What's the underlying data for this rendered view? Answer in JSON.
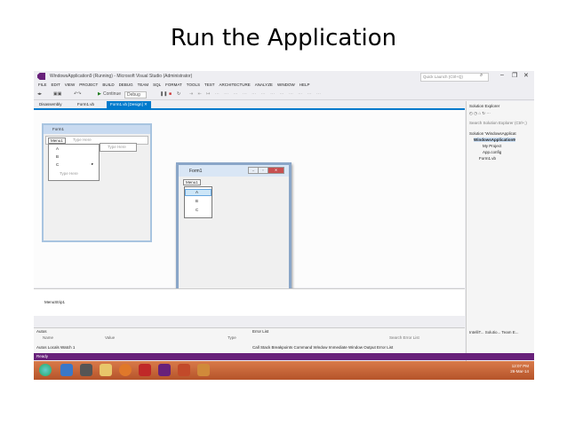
{
  "slide": {
    "title": "Run the Application"
  },
  "window": {
    "title": "WindowsApplication9 (Running) - Microsoft Visual Studio (Administrator)",
    "quick_launch": "Quick Launch (Ctrl+Q)"
  },
  "menu": [
    "FILE",
    "EDIT",
    "VIEW",
    "PROJECT",
    "BUILD",
    "DEBUG",
    "TEAM",
    "SQL",
    "FORMAT",
    "TOOLS",
    "TEST",
    "ARCHITECTURE",
    "ANALYZE",
    "WINDOW",
    "HELP"
  ],
  "toolbar": {
    "continue": "Continue",
    "config": "Debug"
  },
  "tabs": [
    "Disassembly",
    "Form1.vb",
    "Form1.vb [Design]"
  ],
  "designer": {
    "form_caption": "Form1",
    "menu_item": "Menu1",
    "type_here": "Type Here",
    "dropdown": [
      "A",
      "B",
      "C"
    ],
    "sub_type_here": "Type Here",
    "dd_type_here": "Type Here"
  },
  "runtime": {
    "caption": "Form1",
    "menu_item": "Menu1",
    "items": [
      "A",
      "B",
      "C"
    ]
  },
  "tray": {
    "component": "MenuStrip1"
  },
  "solution": {
    "header": "Solution Explorer",
    "search": "Search Solution Explorer (Ctrl+;)",
    "items": [
      "Solution 'WindowsApplicat",
      "WindowsApplication9",
      "My Project",
      "App.config",
      "Form1.vb"
    ]
  },
  "panels": {
    "autos": "Autos",
    "name": "Name",
    "value": "Value",
    "type": "Type",
    "errorlist": "Error List",
    "search_error": "Search Error List",
    "autos_tabs": "Autos  Locals  Watch 1",
    "output_tabs": "Call Stack  Breakpoints  Command Window  Immediate Window  Output  Error List",
    "right_tabs": "IntelliT...  Solutio...  Team E..."
  },
  "status": "Ready",
  "clock": {
    "time": "12:07 PM",
    "date": "26-Mar-14"
  },
  "colors": {
    "vs_purple": "#68217a",
    "accent": "#007acc",
    "taskbar": "#c8643a"
  }
}
